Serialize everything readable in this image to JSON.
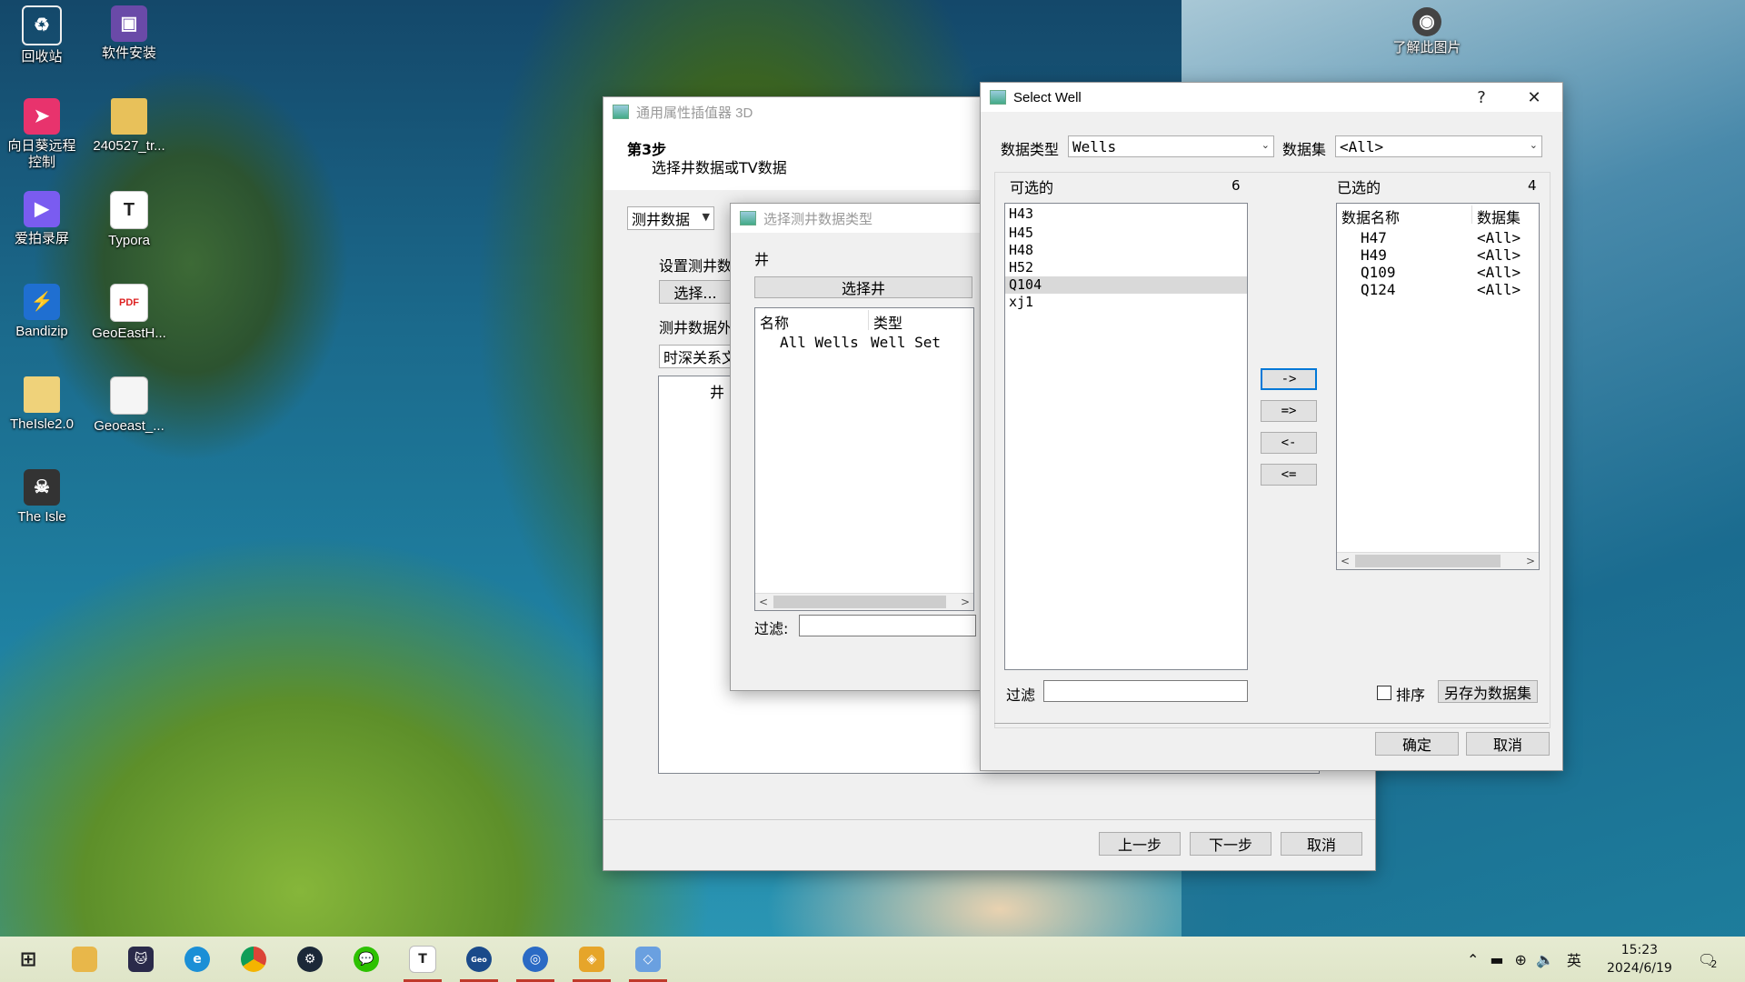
{
  "desktop_icons": [
    {
      "label": "回收站",
      "icon": "recycle-bin-icon"
    },
    {
      "label": "软件安装",
      "icon": "installer-icon"
    },
    {
      "label": "向日葵远程控制",
      "icon": "sunlogin-icon"
    },
    {
      "label": "240527_tr...",
      "icon": "folder-icon"
    },
    {
      "label": "爱拍录屏",
      "icon": "recorder-icon"
    },
    {
      "label": "Typora",
      "icon": "typora-icon"
    },
    {
      "label": "Bandizip",
      "icon": "bandizip-icon"
    },
    {
      "label": "GeoEastH...",
      "icon": "pdf-icon"
    },
    {
      "label": "TheIsle2.0",
      "icon": "folder-icon"
    },
    {
      "label": "Geoeast_...",
      "icon": "file-icon"
    },
    {
      "label": "The Isle",
      "icon": "game-icon"
    },
    {
      "label": "了解此图片",
      "icon": "camera-icon"
    }
  ],
  "wizard": {
    "title": "通用属性插值器 3D",
    "step_title": "第3步",
    "step_desc": "选择井数据或TV数据",
    "data_type_combo": "测井数据",
    "section_label": "设置测井数",
    "select_button": "选择...",
    "outside_label": "测井数据外",
    "relation_field": "时深关系文",
    "column_header": "井",
    "back_button": "上一步",
    "next_button": "下一步",
    "cancel_button": "取消"
  },
  "well_type_dialog": {
    "title": "选择测井数据类型",
    "group_label": "井",
    "select_well_button": "选择井",
    "columns": [
      "名称",
      "类型"
    ],
    "rows": [
      {
        "name": "All Wells",
        "type": "Well Set"
      }
    ],
    "filter_label": "过滤:"
  },
  "select_well": {
    "title": "Select Well",
    "help": "?",
    "close": "✕",
    "data_type_label": "数据类型",
    "data_type_value": "Wells",
    "dataset_label": "数据集",
    "dataset_value": "<All>",
    "available_label": "可选的",
    "available_count": "6",
    "available_items": [
      "H43",
      "H45",
      "H48",
      "H52",
      "Q104",
      "xj1"
    ],
    "available_selected": "Q104",
    "selected_label": "已选的",
    "selected_count": "4",
    "selected_columns": [
      "数据名称",
      "数据集"
    ],
    "selected_rows": [
      {
        "name": "H47",
        "set": "<All>"
      },
      {
        "name": "H49",
        "set": "<All>"
      },
      {
        "name": "Q109",
        "set": "<All>"
      },
      {
        "name": "Q124",
        "set": "<All>"
      }
    ],
    "move_buttons": [
      "->",
      "=>",
      "<-",
      "<="
    ],
    "filter_label": "过滤",
    "sort_label": "排序",
    "save_as_dataset": "另存为数据集",
    "ok": "确定",
    "cancel": "取消"
  },
  "taskbar": {
    "apps": [
      "start-icon",
      "file-explorer-icon",
      "cat-icon",
      "edge-icon",
      "chrome-icon",
      "steam-icon",
      "wechat-icon",
      "typora-icon",
      "geoeast-icon",
      "search-app-icon",
      "geo-app-icon",
      "map-app-icon"
    ],
    "ime": "英",
    "time": "15:23",
    "date": "2024/6/19",
    "notification_count": "2"
  }
}
